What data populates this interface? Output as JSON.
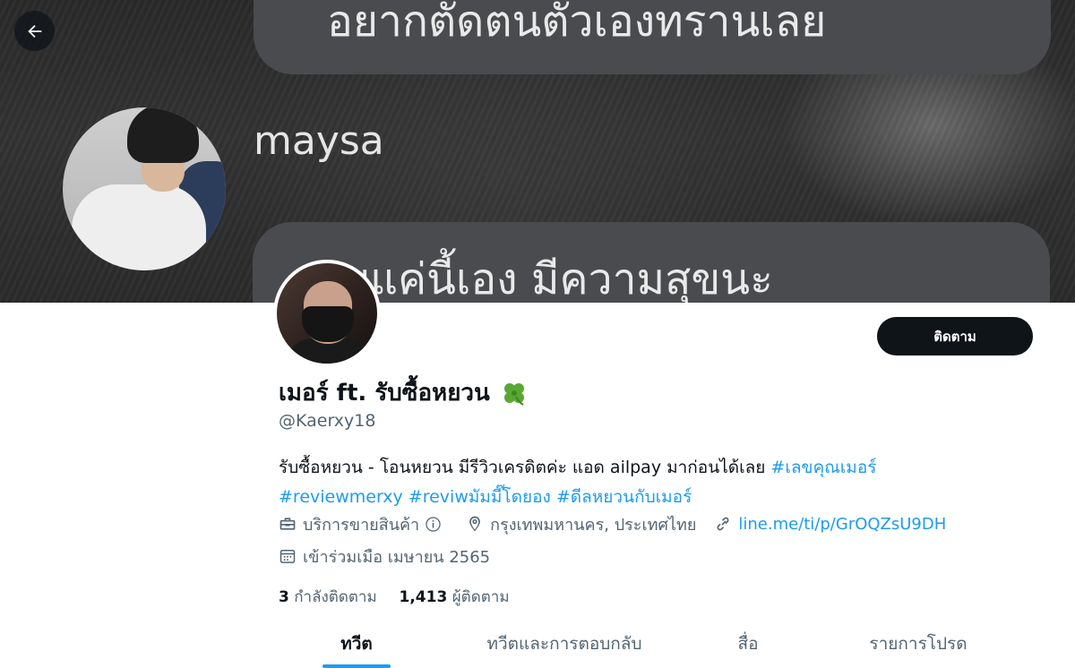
{
  "banner": {
    "top_bubble_text": "อยากตัดตนตัวเองทรานเลย",
    "name_label": "maysa",
    "bottom_bubble_text": "ายุแค่นี้เอง มีความสุขนะ"
  },
  "icons": {
    "back": "arrow-left-icon",
    "clover": "four-leaf-clover-emoji",
    "briefcase": "briefcase-icon",
    "info": "info-icon",
    "location": "location-pin-icon",
    "link": "link-icon",
    "calendar": "calendar-icon"
  },
  "colors": {
    "accent": "#1d9bf0",
    "primary_text": "#0f1419",
    "secondary_text": "#536471",
    "button_bg": "#0f1419"
  },
  "profile": {
    "follow_label": "ติดตาม",
    "display_name": "เมอร์ ft. รับซื้อหยวน",
    "handle": "@Kaerxy18",
    "bio_text": "รับซื้อหยวน - โอนหยวน มีรีวิวเครดิตค่ะ แอด ailpay มาก่อนได้เลย ",
    "bio_hashtags": [
      "#เลขคุณเมอร์",
      "#reviewmerxy",
      "#reviwมัมมี๊โดยอง",
      "#ดีลหยวนกับเมอร์"
    ],
    "category": "บริการขายสินค้า",
    "location": "กรุงเทพมหานคร, ประเทศไทย",
    "link": "line.me/ti/p/GrOQZsU9DH",
    "joined": "เข้าร่วมเมือ เมษายน 2565",
    "following_count": "3",
    "following_label": "กำลังติดตาม",
    "followers_count": "1,413",
    "followers_label": "ผู้ติดตาม"
  },
  "tabs": [
    {
      "label": "ทวีต",
      "active": true
    },
    {
      "label": "ทวีตและการตอบกลับ",
      "active": false
    },
    {
      "label": "สื่อ",
      "active": false
    },
    {
      "label": "รายการโปรด",
      "active": false
    }
  ]
}
